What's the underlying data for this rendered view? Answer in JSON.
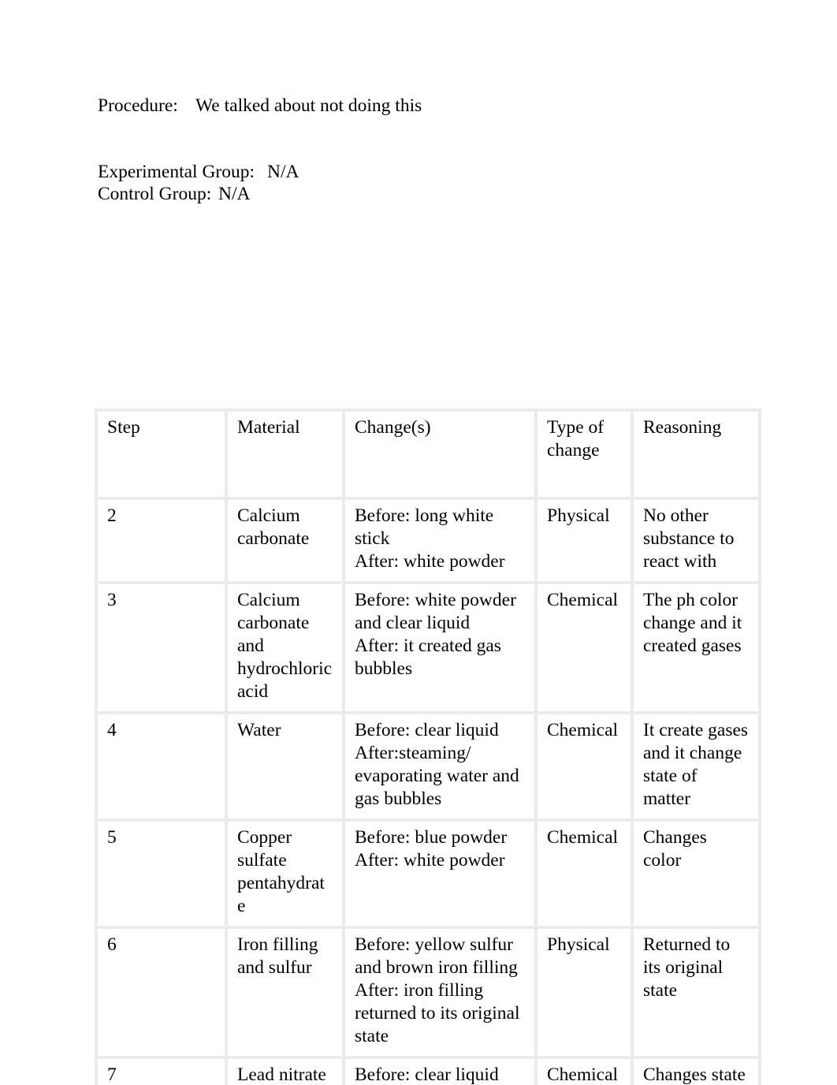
{
  "document": {
    "intro": {
      "procedure_label": "Procedure:",
      "procedure_value": "We talked about not doing this",
      "experimental_group_label": "Experimental Group:",
      "experimental_group_value": "N/A",
      "control_group_label": "Control Group:",
      "control_group_value": "N/A"
    },
    "table": {
      "headers": {
        "step": "Step",
        "material": "Material",
        "changes": "Change(s)",
        "type_of_change": "Type of change",
        "reasoning": "Reasoning"
      },
      "rows": [
        {
          "step": "2",
          "material": "Calcium carbonate",
          "changes_before": "Before: long white stick",
          "changes_after": "After: white powder",
          "type_of_change": "Physical",
          "reasoning": "No other substance to react with"
        },
        {
          "step": "3",
          "material": "Calcium carbonate and hydrochloric acid",
          "changes_before": "Before: white powder and clear liquid",
          "changes_after": "After: it created gas bubbles",
          "type_of_change": "Chemical",
          "reasoning": "The ph color change and it created gases"
        },
        {
          "step": "4",
          "material": "Water",
          "changes_before": "Before: clear liquid",
          "changes_after": "After:steaming/ evaporating water and gas bubbles",
          "type_of_change": "Chemical",
          "reasoning": "It create gases and it change state of matter"
        },
        {
          "step": "5",
          "material": "Copper sulfate pentahydrate",
          "changes_before": "Before: blue powder",
          "changes_after": "After: white powder",
          "type_of_change": "Chemical",
          "reasoning": "Changes color"
        },
        {
          "step": "6",
          "material": "Iron filling and sulfur",
          "changes_before": "Before: yellow sulfur and brown iron filling",
          "changes_after": "After: iron filling returned to its original state",
          "type_of_change": "Physical",
          "reasoning": "Returned to its original state"
        },
        {
          "step": "7",
          "material": "Lead nitrate",
          "changes_before": "Before: clear liquid",
          "changes_after": "",
          "type_of_change": "Chemical",
          "reasoning": "Changes state"
        }
      ]
    }
  }
}
